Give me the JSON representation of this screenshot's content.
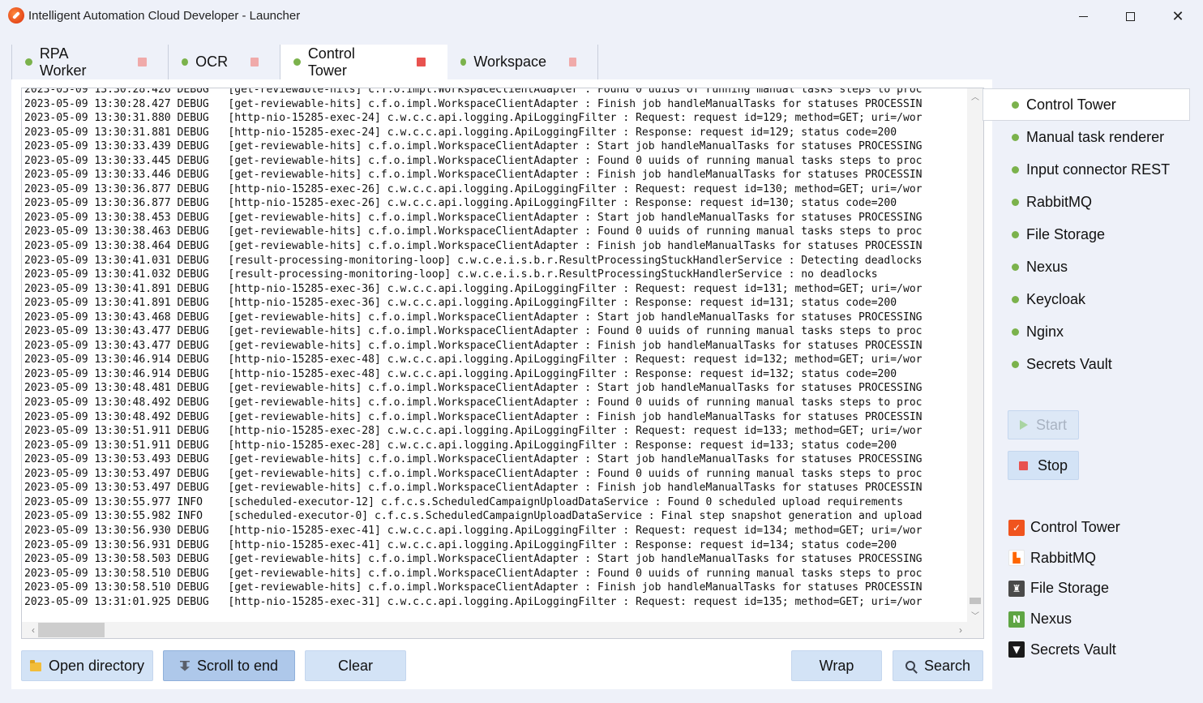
{
  "window": {
    "title": "Intelligent Automation Cloud Developer - Launcher",
    "minimize": "minimize",
    "maximize": "maximize",
    "close": "✕"
  },
  "tabs": [
    {
      "label": "RPA Worker",
      "active": false
    },
    {
      "label": "OCR",
      "active": false
    },
    {
      "label": "Control Tower",
      "active": true
    },
    {
      "label": "Workspace",
      "active": false
    }
  ],
  "log": {
    "lines": [
      "2023-05-09 13:30:28.426 DEBUG   [get-reviewable-hits] c.f.o.impl.WorkspaceClientAdapter : Found 0 uuids of running manual tasks steps to proc",
      "2023-05-09 13:30:28.427 DEBUG   [get-reviewable-hits] c.f.o.impl.WorkspaceClientAdapter : Finish job handleManualTasks for statuses PROCESSIN",
      "2023-05-09 13:30:31.880 DEBUG   [http-nio-15285-exec-24] c.w.c.c.api.logging.ApiLoggingFilter : Request: request id=129; method=GET; uri=/wor",
      "2023-05-09 13:30:31.881 DEBUG   [http-nio-15285-exec-24] c.w.c.c.api.logging.ApiLoggingFilter : Response: request id=129; status code=200",
      "2023-05-09 13:30:33.439 DEBUG   [get-reviewable-hits] c.f.o.impl.WorkspaceClientAdapter : Start job handleManualTasks for statuses PROCESSING",
      "2023-05-09 13:30:33.445 DEBUG   [get-reviewable-hits] c.f.o.impl.WorkspaceClientAdapter : Found 0 uuids of running manual tasks steps to proc",
      "2023-05-09 13:30:33.446 DEBUG   [get-reviewable-hits] c.f.o.impl.WorkspaceClientAdapter : Finish job handleManualTasks for statuses PROCESSIN",
      "2023-05-09 13:30:36.877 DEBUG   [http-nio-15285-exec-26] c.w.c.c.api.logging.ApiLoggingFilter : Request: request id=130; method=GET; uri=/wor",
      "2023-05-09 13:30:36.877 DEBUG   [http-nio-15285-exec-26] c.w.c.c.api.logging.ApiLoggingFilter : Response: request id=130; status code=200",
      "2023-05-09 13:30:38.453 DEBUG   [get-reviewable-hits] c.f.o.impl.WorkspaceClientAdapter : Start job handleManualTasks for statuses PROCESSING",
      "2023-05-09 13:30:38.463 DEBUG   [get-reviewable-hits] c.f.o.impl.WorkspaceClientAdapter : Found 0 uuids of running manual tasks steps to proc",
      "2023-05-09 13:30:38.464 DEBUG   [get-reviewable-hits] c.f.o.impl.WorkspaceClientAdapter : Finish job handleManualTasks for statuses PROCESSIN",
      "2023-05-09 13:30:41.031 DEBUG   [result-processing-monitoring-loop] c.w.c.e.i.s.b.r.ResultProcessingStuckHandlerService : Detecting deadlocks",
      "2023-05-09 13:30:41.032 DEBUG   [result-processing-monitoring-loop] c.w.c.e.i.s.b.r.ResultProcessingStuckHandlerService : no deadlocks",
      "2023-05-09 13:30:41.891 DEBUG   [http-nio-15285-exec-36] c.w.c.c.api.logging.ApiLoggingFilter : Request: request id=131; method=GET; uri=/wor",
      "2023-05-09 13:30:41.891 DEBUG   [http-nio-15285-exec-36] c.w.c.c.api.logging.ApiLoggingFilter : Response: request id=131; status code=200",
      "2023-05-09 13:30:43.468 DEBUG   [get-reviewable-hits] c.f.o.impl.WorkspaceClientAdapter : Start job handleManualTasks for statuses PROCESSING",
      "2023-05-09 13:30:43.477 DEBUG   [get-reviewable-hits] c.f.o.impl.WorkspaceClientAdapter : Found 0 uuids of running manual tasks steps to proc",
      "2023-05-09 13:30:43.477 DEBUG   [get-reviewable-hits] c.f.o.impl.WorkspaceClientAdapter : Finish job handleManualTasks for statuses PROCESSIN",
      "2023-05-09 13:30:46.914 DEBUG   [http-nio-15285-exec-48] c.w.c.c.api.logging.ApiLoggingFilter : Request: request id=132; method=GET; uri=/wor",
      "2023-05-09 13:30:46.914 DEBUG   [http-nio-15285-exec-48] c.w.c.c.api.logging.ApiLoggingFilter : Response: request id=132; status code=200",
      "2023-05-09 13:30:48.481 DEBUG   [get-reviewable-hits] c.f.o.impl.WorkspaceClientAdapter : Start job handleManualTasks for statuses PROCESSING",
      "2023-05-09 13:30:48.492 DEBUG   [get-reviewable-hits] c.f.o.impl.WorkspaceClientAdapter : Found 0 uuids of running manual tasks steps to proc",
      "2023-05-09 13:30:48.492 DEBUG   [get-reviewable-hits] c.f.o.impl.WorkspaceClientAdapter : Finish job handleManualTasks for statuses PROCESSIN",
      "2023-05-09 13:30:51.911 DEBUG   [http-nio-15285-exec-28] c.w.c.c.api.logging.ApiLoggingFilter : Request: request id=133; method=GET; uri=/wor",
      "2023-05-09 13:30:51.911 DEBUG   [http-nio-15285-exec-28] c.w.c.c.api.logging.ApiLoggingFilter : Response: request id=133; status code=200",
      "2023-05-09 13:30:53.493 DEBUG   [get-reviewable-hits] c.f.o.impl.WorkspaceClientAdapter : Start job handleManualTasks for statuses PROCESSING",
      "2023-05-09 13:30:53.497 DEBUG   [get-reviewable-hits] c.f.o.impl.WorkspaceClientAdapter : Found 0 uuids of running manual tasks steps to proc",
      "2023-05-09 13:30:53.497 DEBUG   [get-reviewable-hits] c.f.o.impl.WorkspaceClientAdapter : Finish job handleManualTasks for statuses PROCESSIN",
      "2023-05-09 13:30:55.977 INFO    [scheduled-executor-12] c.f.c.s.ScheduledCampaignUploadDataService : Found 0 scheduled upload requirements",
      "2023-05-09 13:30:55.982 INFO    [scheduled-executor-0] c.f.c.s.ScheduledCampaignUploadDataService : Final step snapshot generation and upload",
      "2023-05-09 13:30:56.930 DEBUG   [http-nio-15285-exec-41] c.w.c.c.api.logging.ApiLoggingFilter : Request: request id=134; method=GET; uri=/wor",
      "2023-05-09 13:30:56.931 DEBUG   [http-nio-15285-exec-41] c.w.c.c.api.logging.ApiLoggingFilter : Response: request id=134; status code=200",
      "2023-05-09 13:30:58.503 DEBUG   [get-reviewable-hits] c.f.o.impl.WorkspaceClientAdapter : Start job handleManualTasks for statuses PROCESSING",
      "2023-05-09 13:30:58.510 DEBUG   [get-reviewable-hits] c.f.o.impl.WorkspaceClientAdapter : Found 0 uuids of running manual tasks steps to proc",
      "2023-05-09 13:30:58.510 DEBUG   [get-reviewable-hits] c.f.o.impl.WorkspaceClientAdapter : Finish job handleManualTasks for statuses PROCESSIN",
      "2023-05-09 13:31:01.925 DEBUG   [http-nio-15285-exec-31] c.w.c.c.api.logging.ApiLoggingFilter : Request: request id=135; method=GET; uri=/wor"
    ]
  },
  "toolbar": {
    "open_directory": "Open directory",
    "scroll_to_end": "Scroll to end",
    "clear": "Clear",
    "wrap": "Wrap",
    "search": "Search"
  },
  "services": [
    {
      "label": "Control Tower",
      "selected": true
    },
    {
      "label": "Manual task renderer",
      "selected": false
    },
    {
      "label": "Input connector REST",
      "selected": false
    },
    {
      "label": "RabbitMQ",
      "selected": false
    },
    {
      "label": "File Storage",
      "selected": false
    },
    {
      "label": "Nexus",
      "selected": false
    },
    {
      "label": "Keycloak",
      "selected": false
    },
    {
      "label": "Nginx",
      "selected": false
    },
    {
      "label": "Secrets Vault",
      "selected": false
    }
  ],
  "controls": {
    "start": "Start",
    "stop": "Stop"
  },
  "links": [
    {
      "label": "Control Tower",
      "icon": "control-tower-icon",
      "glyph": "✓"
    },
    {
      "label": "RabbitMQ",
      "icon": "rabbitmq-icon",
      "glyph": "▙"
    },
    {
      "label": "File Storage",
      "icon": "file-storage-icon",
      "glyph": "♜"
    },
    {
      "label": "Nexus",
      "icon": "nexus-icon",
      "glyph": "N"
    },
    {
      "label": "Secrets Vault",
      "icon": "secrets-vault-icon",
      "glyph": "▼"
    }
  ],
  "colors": {
    "accent": "#d3e3f6",
    "status_running": "#7bb24c",
    "stop": "#e8524f",
    "background": "#eef1f9"
  }
}
